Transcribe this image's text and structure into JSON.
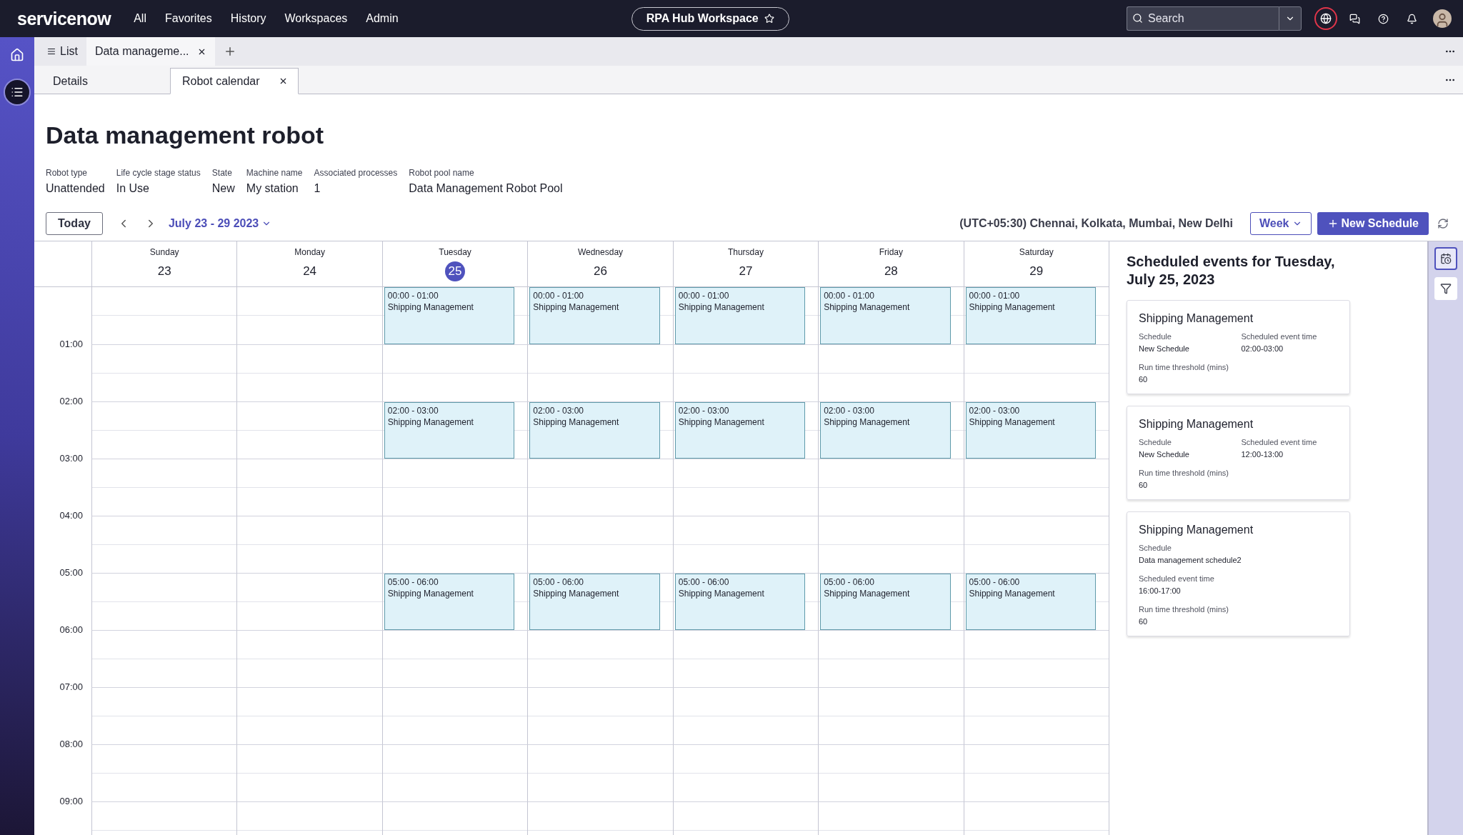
{
  "topbar": {
    "logo": "servicenow",
    "nav": [
      "All",
      "Favorites",
      "History",
      "Workspaces",
      "Admin"
    ],
    "workspace": "RPA Hub Workspace",
    "search": {
      "placeholder": "Search"
    }
  },
  "tabs": [
    {
      "label": "List",
      "kind": "list",
      "selected": false
    },
    {
      "label": "Data manageme...",
      "kind": "record",
      "selected": true
    }
  ],
  "subtabs": [
    {
      "label": "Details",
      "selected": false
    },
    {
      "label": "Robot calendar",
      "selected": true
    }
  ],
  "record": {
    "title": "Data management robot",
    "fields": [
      {
        "label": "Robot type",
        "value": "Unattended"
      },
      {
        "label": "Life cycle stage status",
        "value": "In Use"
      },
      {
        "label": "State",
        "value": "New"
      },
      {
        "label": "Machine name",
        "value": "My station"
      },
      {
        "label": "Associated processes",
        "value": "1"
      },
      {
        "label": "Robot pool name",
        "value": "Data Management Robot Pool"
      }
    ]
  },
  "toolbar": {
    "today": "Today",
    "range": "July 23 - 29 2023",
    "timezone": "(UTC+05:30) Chennai, Kolkata, Mumbai, New Delhi",
    "view": "Week",
    "new_button": "New Schedule"
  },
  "calendar": {
    "days": [
      {
        "name": "Sunday",
        "date": "23",
        "selected": false
      },
      {
        "name": "Monday",
        "date": "24",
        "selected": false
      },
      {
        "name": "Tuesday",
        "date": "25",
        "selected": true
      },
      {
        "name": "Wednesday",
        "date": "26",
        "selected": false
      },
      {
        "name": "Thursday",
        "date": "27",
        "selected": false
      },
      {
        "name": "Friday",
        "date": "28",
        "selected": false
      },
      {
        "name": "Saturday",
        "date": "29",
        "selected": false
      }
    ],
    "rows": [
      {
        "events": [
          {
            "kind": "empty"
          },
          {
            "kind": "empty"
          },
          {
            "kind": "event",
            "time": "00:00 - 01:00",
            "title": "Shipping Management"
          },
          {
            "kind": "event",
            "time": "00:00 - 01:00",
            "title": "Shipping Management"
          },
          {
            "kind": "event",
            "time": "00:00 - 01:00",
            "title": "Shipping Management"
          },
          {
            "kind": "event",
            "time": "00:00 - 01:00",
            "title": "Shipping Management"
          },
          {
            "kind": "event",
            "time": "00:00 - 01:00",
            "title": "Shipping Management"
          }
        ]
      },
      {
        "label": "01:00"
      },
      {
        "label": "02:00",
        "events": [
          {
            "kind": "empty"
          },
          {
            "kind": "empty"
          },
          {
            "kind": "event",
            "time": "02:00 - 03:00",
            "title": "Shipping Management"
          },
          {
            "kind": "event",
            "time": "02:00 - 03:00",
            "title": "Shipping Management"
          },
          {
            "kind": "event",
            "time": "02:00 - 03:00",
            "title": "Shipping Management"
          },
          {
            "kind": "event",
            "time": "02:00 - 03:00",
            "title": "Shipping Management"
          },
          {
            "kind": "event",
            "time": "02:00 - 03:00",
            "title": "Shipping Management"
          }
        ]
      },
      {
        "label": "03:00"
      },
      {
        "label": "04:00"
      },
      {
        "label": "05:00",
        "events": [
          {
            "kind": "empty"
          },
          {
            "kind": "empty"
          },
          {
            "kind": "event",
            "time": "05:00 - 06:00",
            "title": "Shipping Management"
          },
          {
            "kind": "event",
            "time": "05:00 - 06:00",
            "title": "Shipping Management"
          },
          {
            "kind": "event",
            "time": "05:00 - 06:00",
            "title": "Shipping Management"
          },
          {
            "kind": "event",
            "time": "05:00 - 06:00",
            "title": "Shipping Management"
          },
          {
            "kind": "event",
            "time": "05:00 - 06:00",
            "title": "Shipping Management"
          }
        ]
      },
      {
        "label": "06:00"
      },
      {
        "label": "07:00"
      },
      {
        "label": "08:00"
      },
      {
        "label": "09:00"
      }
    ]
  },
  "panel": {
    "title": "Scheduled events for Tuesday, July 25, 2023",
    "cards": [
      {
        "kind": "columns",
        "title": "Shipping Management",
        "fields": [
          {
            "label": "Schedule",
            "value": "New Schedule"
          },
          {
            "label": "Scheduled event time",
            "value": "02:00-03:00"
          },
          {
            "label": "Run time threshold (mins)",
            "value": "60"
          }
        ]
      },
      {
        "kind": "columns",
        "title": "Shipping Management",
        "fields": [
          {
            "label": "Schedule",
            "value": "New Schedule"
          },
          {
            "label": "Scheduled event time",
            "value": "12:00-13:00"
          },
          {
            "label": "Run time threshold (mins)",
            "value": "60"
          }
        ]
      },
      {
        "kind": "stacked",
        "title": "Shipping Management",
        "fields": [
          {
            "label": "Schedule",
            "value": "Data management schedule2"
          },
          {
            "label": "Scheduled event time",
            "value": "16:00-17:00"
          },
          {
            "label": "Run time threshold (mins)",
            "value": "60"
          }
        ]
      }
    ]
  },
  "rail": [
    {
      "kind": "calendar",
      "selected": true
    },
    {
      "kind": "filter",
      "selected": false
    }
  ]
}
